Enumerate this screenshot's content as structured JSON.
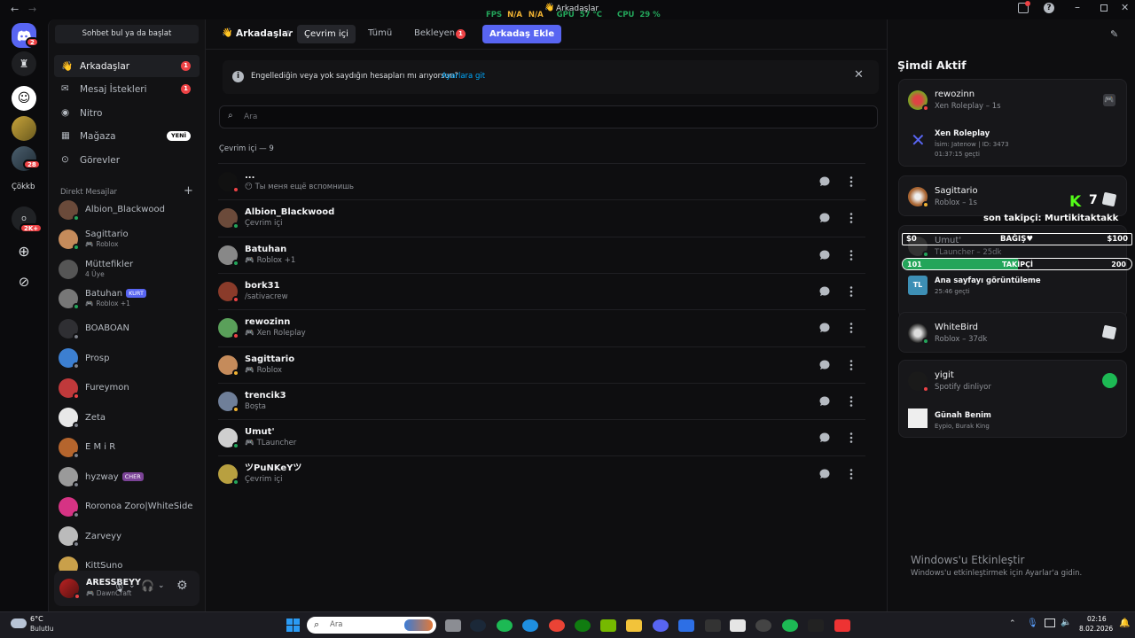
{
  "topbar": {
    "fps_label": "FPS",
    "fps_value": "N/A",
    "fps_value2": "N/A",
    "gpu_label": "GPU",
    "gpu_value": "57 °C",
    "cpu_label": "CPU",
    "cpu_value": "29 %",
    "title": "Arkadaşlar"
  },
  "servers": {
    "home_badge": "2",
    "badge_28": "28",
    "folder_label": "Çökkb",
    "badge_2k": "2K+"
  },
  "dm": {
    "search_placeholder": "Sohbet bul ya da başlat",
    "nav": [
      {
        "label": "Arkadaşlar",
        "badge": "1"
      },
      {
        "label": "Mesaj İstekleri",
        "badge": "1"
      },
      {
        "label": "Nitro"
      },
      {
        "label": "Mağaza",
        "badge": "YENİ"
      },
      {
        "label": "Görevler"
      }
    ],
    "section_label": "Direkt Mesajlar",
    "items": [
      {
        "name": "Albion_Blackwood",
        "sub": "",
        "status": "online"
      },
      {
        "name": "Sagittario",
        "sub": "Roblox",
        "status": "online"
      },
      {
        "name": "Müttefikler",
        "sub": "4 Üye",
        "status": ""
      },
      {
        "name": "Batuhan",
        "tag": "KURT",
        "sub": "Roblox +1",
        "status": "online"
      },
      {
        "name": "BOABOAN",
        "sub": "",
        "status": "offline"
      },
      {
        "name": "Prosp",
        "sub": "",
        "status": "offline"
      },
      {
        "name": "Fureymon",
        "sub": "",
        "status": "dnd"
      },
      {
        "name": "Zeta",
        "sub": "",
        "status": "offline"
      },
      {
        "name": "E M i R",
        "sub": "",
        "status": "offline"
      },
      {
        "name": "hyzway",
        "tag": "CHER",
        "sub": "",
        "status": "offline"
      },
      {
        "name": "Roronoa Zoro|WhiteSide",
        "sub": "",
        "status": "offline"
      },
      {
        "name": "Zarveyy",
        "sub": "",
        "status": "offline"
      },
      {
        "name": "KittSuno",
        "sub": "",
        "status": "offline"
      }
    ]
  },
  "user": {
    "name": "ARESSBEYY",
    "activity": "DawnCraft"
  },
  "main": {
    "title": "Arkadaşlar",
    "tabs": [
      {
        "label": "Çevrim içi"
      },
      {
        "label": "Tümü"
      },
      {
        "label": "Bekleyen",
        "badge": "1"
      }
    ],
    "add_friend_label": "Arkadaş Ekle",
    "banner_text": "Engellediğin veya yok saydığın hesapları mı arıyorsun?",
    "banner_link": "Ayarlara git",
    "search_placeholder": "Ara",
    "section_header": "Çevrim içi — 9",
    "friends": [
      {
        "name": "...",
        "sub": "😶 Ты меня ещё вспомнишь",
        "status": "dnd"
      },
      {
        "name": "Albion_Blackwood",
        "sub": "Çevrim içi",
        "status": "online"
      },
      {
        "name": "Batuhan",
        "sub": "Roblox +1",
        "game": true,
        "status": "online"
      },
      {
        "name": "bork31",
        "sub": "/sativacrew",
        "status": "dnd"
      },
      {
        "name": "rewozinn",
        "sub": "Xen Roleplay",
        "game": true,
        "status": "dnd"
      },
      {
        "name": "Sagittario",
        "sub": "Roblox",
        "game": true,
        "status": "idle"
      },
      {
        "name": "trencik3",
        "sub": "Boşta",
        "status": "idle"
      },
      {
        "name": "Umut'",
        "sub": "TLauncher",
        "game": true,
        "status": "online"
      },
      {
        "name": "ツPuNKeYツ",
        "sub": "Çevrim içi",
        "status": "online"
      }
    ]
  },
  "active": {
    "title": "Şimdi Aktif",
    "cards": [
      {
        "name": "rewozinn",
        "sub": "Xen Roleplay – 1s",
        "detail_title": "Xen Roleplay",
        "detail_l1": "İsim: Jatenow | ID: 3473",
        "detail_l2": "01:37:15 geçti"
      },
      {
        "name": "Sagittario",
        "sub": "Roblox – 1s"
      },
      {
        "name": "Umut'",
        "sub": "TLauncher – 25dk",
        "detail_title": "Ana sayfayı görüntüleme",
        "detail_l1": "25:46 geçti",
        "tl": "TL"
      },
      {
        "name": "WhiteBird",
        "sub": "Roblox – 37dk"
      },
      {
        "name": "yigit",
        "sub": "Spotify dinliyor",
        "detail_title": "Günah Benim",
        "detail_l1": "Eypio, Burak King"
      }
    ]
  },
  "overlay": {
    "k_count": "7",
    "last_follower": "son takipçi: Murtikitaktakk",
    "donation_left": "$0",
    "donation_label": "BAĞIŞ♥",
    "donation_right": "$100",
    "follow_left": "101",
    "follow_label": "TAKİPÇİ",
    "follow_right": "200",
    "follow_progress": 0.505
  },
  "watermark": {
    "line1": "Windows'u Etkinleştir",
    "line2": "Windows'u etkinleştirmek için Ayarlar'a gidin."
  },
  "taskbar": {
    "weather_temp": "6°C",
    "weather_desc": "Bulutlu",
    "search_placeholder": "Ara",
    "time": "02:16",
    "date": "8.02.2026"
  },
  "colors": {
    "accent": "#5865f2",
    "online": "#23a55a",
    "dnd": "#ed4245",
    "idle": "#f0b232",
    "background": "#0e0e10"
  }
}
